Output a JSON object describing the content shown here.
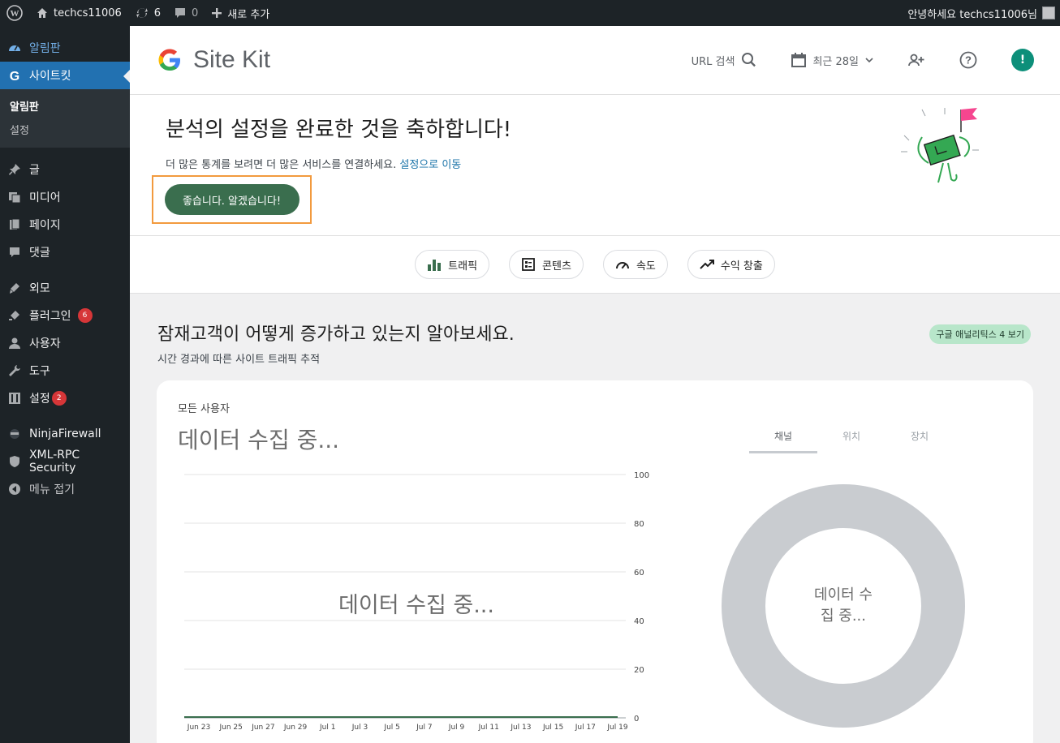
{
  "adminbar": {
    "site_name": "techcs11006",
    "updates_count": "6",
    "comments_count": "0",
    "new_label": "새로 추가",
    "greeting": "안녕하세요 techcs11006님"
  },
  "sidebar": {
    "items": [
      {
        "label": "알림판",
        "icon": "dashboard-icon"
      },
      {
        "label": "사이트킷",
        "icon": "google-g-icon"
      },
      {
        "label": "글",
        "icon": "pin-icon"
      },
      {
        "label": "미디어",
        "icon": "media-icon"
      },
      {
        "label": "페이지",
        "icon": "page-icon"
      },
      {
        "label": "댓글",
        "icon": "comment-icon"
      },
      {
        "label": "외모",
        "icon": "brush-icon"
      },
      {
        "label": "플러그인",
        "icon": "plugin-icon",
        "badge": "6"
      },
      {
        "label": "사용자",
        "icon": "user-icon"
      },
      {
        "label": "도구",
        "icon": "wrench-icon"
      },
      {
        "label": "설정",
        "icon": "settings-icon",
        "badge": "2"
      },
      {
        "label": "NinjaFirewall",
        "icon": "ninja-icon"
      },
      {
        "label": "XML-RPC Security",
        "icon": "shield-icon"
      },
      {
        "label": "메뉴 접기",
        "icon": "collapse-icon"
      }
    ],
    "submenu": [
      "알림판",
      "설정"
    ]
  },
  "header": {
    "brand": "Site Kit",
    "url_search": "URL 검색",
    "date_range": "최근 28일",
    "alert": "!"
  },
  "banner": {
    "title": "분석의 설정을 완료한 것을 축하합니다!",
    "desc": "더 많은 통계를 보려면 더 많은 서비스를 연결하세요.",
    "link": "설정으로 이동",
    "ack": "좋습니다. 알겠습니다!"
  },
  "chips": [
    {
      "label": "트래픽",
      "icon": "bars-icon"
    },
    {
      "label": "콘텐츠",
      "icon": "content-icon"
    },
    {
      "label": "속도",
      "icon": "speed-icon"
    },
    {
      "label": "수익 창출",
      "icon": "trend-icon"
    }
  ],
  "section": {
    "title": "잠재고객이 어떻게 증가하고 있는지 알아보세요.",
    "subtitle": "시간 경과에 따른 사이트 트래픽 추적",
    "ga_link": "구글 애널리틱스 4 보기"
  },
  "card": {
    "label": "모든 사용자",
    "big": "데이터 수집 중...",
    "tabs": [
      "채널",
      "위치",
      "장치"
    ],
    "donut_text": [
      "데이터 수",
      "집 중..."
    ]
  },
  "chart_data": {
    "type": "line",
    "title": "",
    "overlay": "데이터 수집 중...",
    "categories": [
      "Jun 23",
      "Jun 25",
      "Jun 27",
      "Jun 29",
      "Jul 1",
      "Jul 3",
      "Jul 5",
      "Jul 7",
      "Jul 9",
      "Jul 11",
      "Jul 13",
      "Jul 15",
      "Jul 17",
      "Jul 19"
    ],
    "values": [
      0,
      0,
      0,
      0,
      0,
      0,
      0,
      0,
      0,
      0,
      0,
      0,
      0,
      0
    ],
    "yticks": [
      100,
      80,
      60,
      40,
      20,
      0
    ],
    "ylim": [
      0,
      100
    ],
    "line_color": "#3a6e4e"
  },
  "colors": {
    "accent_green": "#3a6e4e",
    "wp_blue": "#2271b1",
    "highlight_orange": "#f29a3e",
    "donut_gray": "#c9ccd0"
  }
}
